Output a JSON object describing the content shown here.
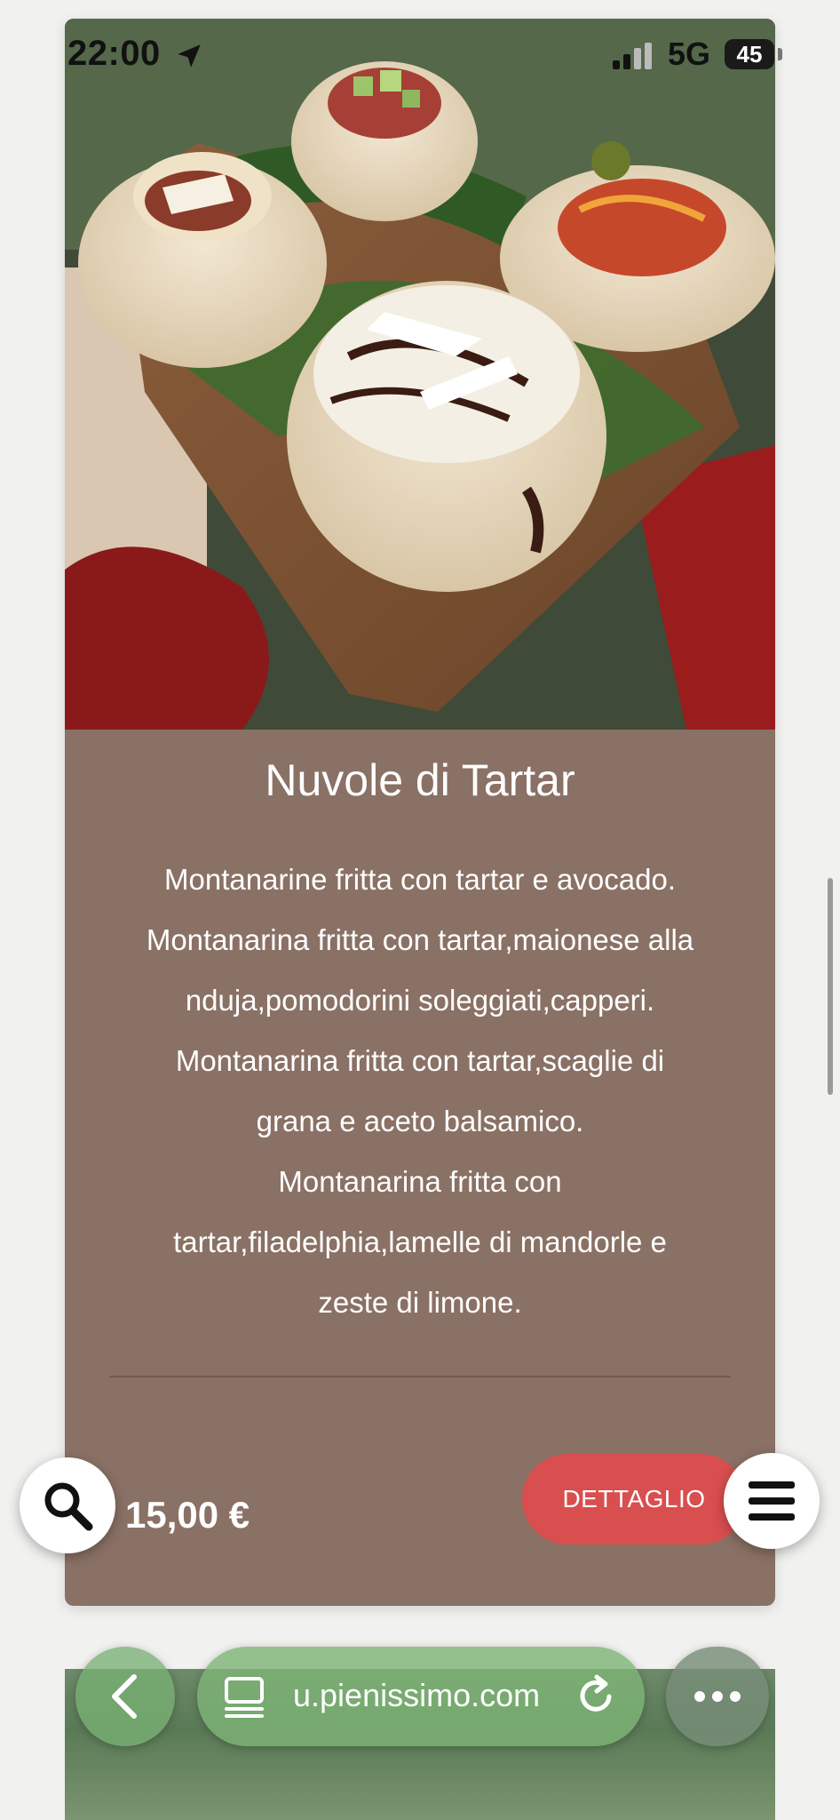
{
  "status_bar": {
    "time": "22:00",
    "network": "5G",
    "battery": "45",
    "icons": [
      "location-arrow-icon",
      "signal-icon",
      "battery-icon"
    ]
  },
  "product": {
    "title": "Nuvole di Tartar",
    "description_lines": [
      "Montanarine fritta con tartar e avocado.",
      "Montanarina fritta con tartar,maionese alla",
      "nduja,pomodorini soleggiati,capperi.",
      "Montanarina fritta con tartar,scaglie di",
      "grana e aceto balsamico.",
      "Montanarina fritta con",
      "tartar,filadelphia,lamelle di mandorle e",
      "zeste di limone."
    ],
    "price": "15,00 €",
    "detail_button": "DETTAGLIO"
  },
  "floating": {
    "search_icon": "search-icon",
    "menu_icon": "hamburger-menu-icon"
  },
  "browser_bar": {
    "url": "u.pienissimo.com",
    "icons": [
      "back-chevron-icon",
      "tab-icon",
      "reload-icon",
      "more-icon"
    ]
  },
  "colors": {
    "card_background": "#8a7165",
    "button_red": "#d94e4e",
    "page_background": "#f1f1ef"
  }
}
